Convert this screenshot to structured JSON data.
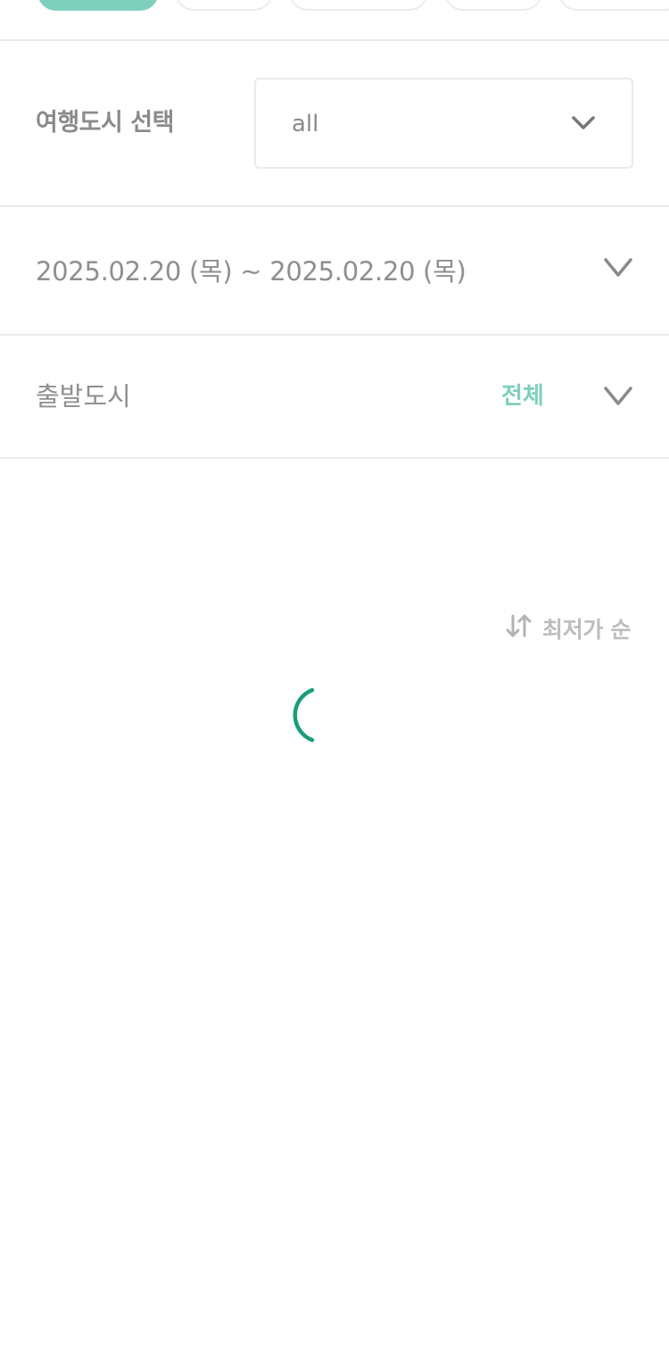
{
  "category_chips": [
    {
      "state": "active"
    },
    {
      "state": "inactive"
    },
    {
      "state": "inactive"
    },
    {
      "state": "inactive"
    },
    {
      "state": "inactive"
    }
  ],
  "city_select": {
    "label": "여행도시 선택",
    "value": "all",
    "icon": "chevron-down-icon"
  },
  "date_range": {
    "text": "2025.02.20 (목) ~ 2025.02.20 (목)",
    "icon": "chevron-down-icon"
  },
  "departure_city": {
    "label": "출발도시",
    "value": "전체",
    "icon": "chevron-down-icon"
  },
  "sort": {
    "label": "최저가 순",
    "icon": "sort-arrows-icon"
  },
  "loading": {
    "icon": "loading-spinner-icon"
  },
  "colors": {
    "accent": "#7fd0bb",
    "spinner": "#1a9e7a",
    "text_muted": "#8f8f8f",
    "divider": "#ebebeb"
  }
}
